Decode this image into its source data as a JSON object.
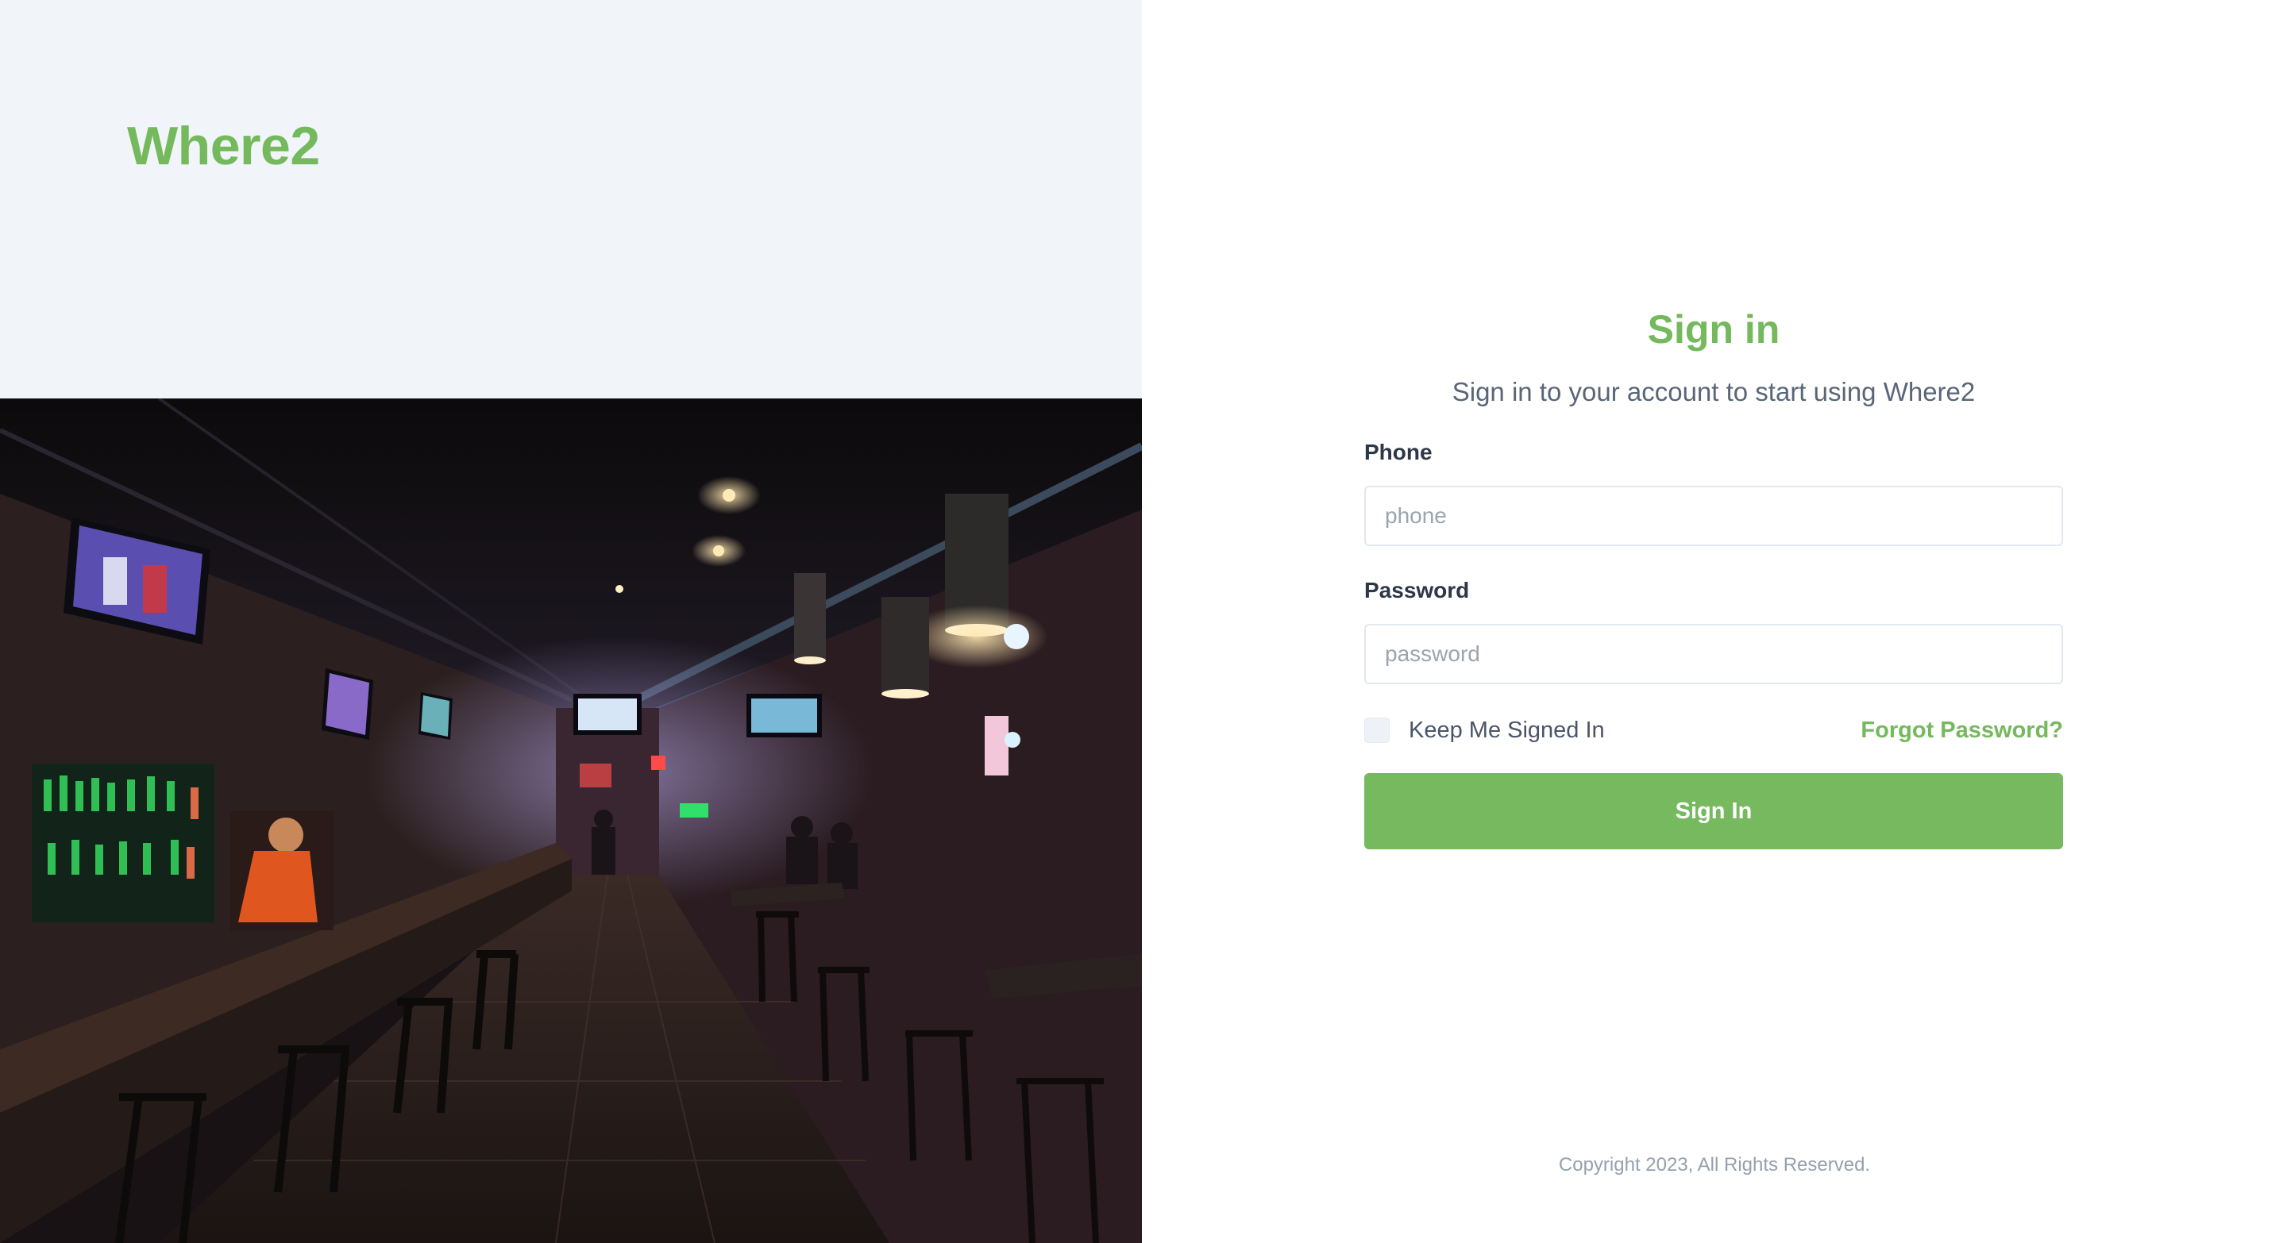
{
  "brand": {
    "name": "Where2",
    "color": "#74b95c"
  },
  "hero_image": {
    "alt": "Sports bar interior with long counter, bar stools and wall-mounted TVs"
  },
  "signin": {
    "title": "Sign in",
    "subtitle": "Sign in to your account to start using Where2",
    "phone": {
      "label": "Phone",
      "placeholder": "phone",
      "value": ""
    },
    "password": {
      "label": "Password",
      "placeholder": "password",
      "value": ""
    },
    "remember": {
      "label": "Keep Me Signed In",
      "checked": false
    },
    "forgot_label": "Forgot Password?",
    "submit_label": "Sign In"
  },
  "footer": {
    "copyright": "Copyright 2023, All Rights Reserved."
  },
  "colors": {
    "accent": "#76b95e",
    "left_bg": "#f1f4f8",
    "text_dark": "#2d3748",
    "text_muted": "#5a6678"
  }
}
